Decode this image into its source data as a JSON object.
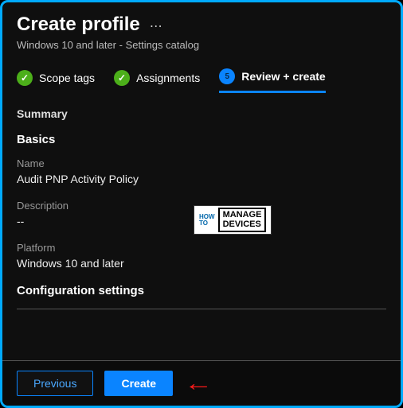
{
  "header": {
    "title": "Create profile",
    "subtitle": "Windows 10 and later - Settings catalog"
  },
  "tabs": [
    {
      "label": "Scope tags"
    },
    {
      "label": "Assignments"
    },
    {
      "step": "5",
      "label": "Review + create"
    }
  ],
  "summary": {
    "title": "Summary",
    "basics": {
      "heading": "Basics",
      "name_label": "Name",
      "name_value": "Audit PNP Activity Policy",
      "description_label": "Description",
      "description_value": "--",
      "platform_label": "Platform",
      "platform_value": "Windows 10 and later"
    },
    "config_heading": "Configuration settings"
  },
  "footer": {
    "previous": "Previous",
    "create": "Create"
  },
  "watermark": {
    "left_top": "HOW",
    "left_bottom": "TO",
    "right_top": "MANAGE",
    "right_bottom": "DEVICES"
  }
}
